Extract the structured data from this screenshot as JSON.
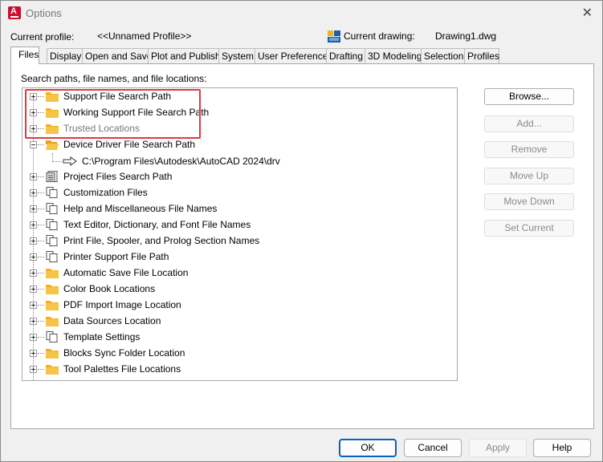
{
  "window": {
    "title": "Options",
    "close_glyph": "✕"
  },
  "profile": {
    "current_profile_label": "Current profile:",
    "current_profile_value": "<<Unnamed Profile>>",
    "current_drawing_label": "Current drawing:",
    "current_drawing_value": "Drawing1.dwg"
  },
  "tabs": [
    {
      "label": "Files",
      "active": true
    },
    {
      "label": "Display"
    },
    {
      "label": "Open and Save"
    },
    {
      "label": "Plot and Publish"
    },
    {
      "label": "System"
    },
    {
      "label": "User Preferences"
    },
    {
      "label": "Drafting"
    },
    {
      "label": "3D Modeling"
    },
    {
      "label": "Selection"
    },
    {
      "label": "Profiles"
    }
  ],
  "files": {
    "caption": "Search paths, file names, and file locations:",
    "tree": [
      {
        "label": "Support File Search Path",
        "icon": "folder-icon",
        "expanded": false
      },
      {
        "label": "Working Support File Search Path",
        "icon": "folder-icon",
        "expanded": false
      },
      {
        "label": "Trusted Locations",
        "icon": "folder-icon",
        "expanded": false,
        "dimmed": true
      },
      {
        "label": "Device Driver File Search Path",
        "icon": "open-folder-icon",
        "expanded": true,
        "children": [
          {
            "label": "C:\\Program Files\\Autodesk\\AutoCAD 2024\\drv",
            "icon": "arrow-right-icon"
          }
        ]
      },
      {
        "label": "Project Files Search Path",
        "icon": "document-icon",
        "expanded": false
      },
      {
        "label": "Customization Files",
        "icon": "files-icon",
        "expanded": false
      },
      {
        "label": "Help and Miscellaneous File Names",
        "icon": "files-icon",
        "expanded": false
      },
      {
        "label": "Text Editor, Dictionary, and Font File Names",
        "icon": "files-icon",
        "expanded": false
      },
      {
        "label": "Print File, Spooler, and Prolog Section Names",
        "icon": "files-icon",
        "expanded": false
      },
      {
        "label": "Printer Support File Path",
        "icon": "files-icon",
        "expanded": false
      },
      {
        "label": "Automatic Save File Location",
        "icon": "folder-icon",
        "expanded": false
      },
      {
        "label": "Color Book Locations",
        "icon": "folder-icon",
        "expanded": false
      },
      {
        "label": "PDF Import Image Location",
        "icon": "folder-icon",
        "expanded": false
      },
      {
        "label": "Data Sources Location",
        "icon": "folder-icon",
        "expanded": false
      },
      {
        "label": "Template Settings",
        "icon": "files-icon",
        "expanded": false
      },
      {
        "label": "Blocks Sync Folder Location",
        "icon": "folder-icon",
        "expanded": false
      },
      {
        "label": "Tool Palettes File Locations",
        "icon": "folder-icon",
        "expanded": false
      }
    ],
    "buttons": {
      "browse": "Browse...",
      "add": "Add...",
      "remove": "Remove",
      "move_up": "Move Up",
      "move_down": "Move Down",
      "set_current": "Set Current"
    }
  },
  "dialog_buttons": {
    "ok": "OK",
    "cancel": "Cancel",
    "apply": "Apply",
    "help": "Help"
  },
  "colors": {
    "highlight_box": "#e0393e",
    "folder": "#f2b01e",
    "primary_button_border": "#0b5fbe",
    "app_icon": "#c8102e"
  }
}
